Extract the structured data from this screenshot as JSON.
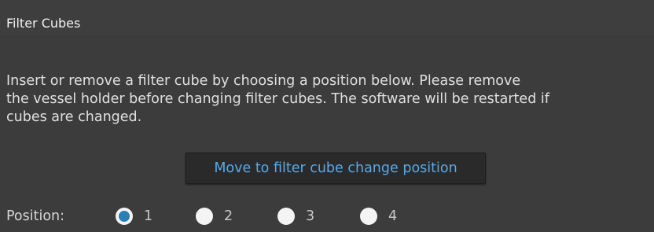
{
  "panel": {
    "title": "Filter Cubes",
    "description": "Insert or remove a filter cube by choosing a position below. Please remove\nthe vessel holder before changing filter cubes. The software will be restarted if\ncubes are changed.",
    "move_button_label": "Move to filter cube change position"
  },
  "position": {
    "label": "Position:",
    "options": [
      {
        "label": "1",
        "checked": true
      },
      {
        "label": "2",
        "checked": false
      },
      {
        "label": "3",
        "checked": false
      },
      {
        "label": "4",
        "checked": false
      }
    ]
  },
  "colors": {
    "background": "#3c3c3c",
    "button_text": "#5aa9e6",
    "radio_selected": "#2b7fb6"
  }
}
